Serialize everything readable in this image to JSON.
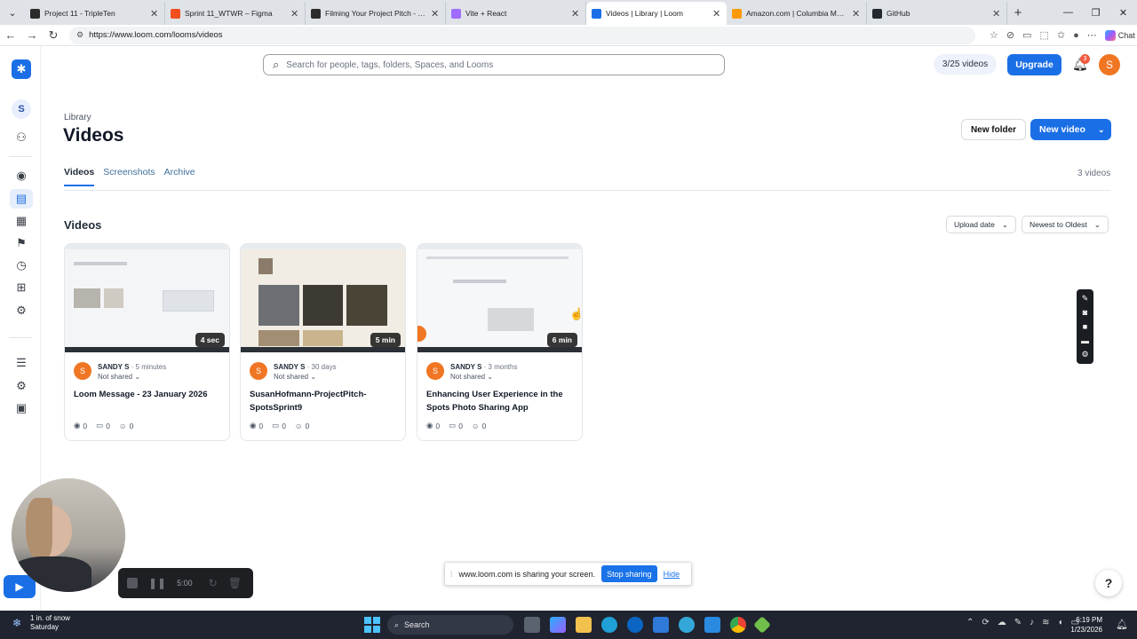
{
  "browser": {
    "tabs": [
      {
        "title": "Project 11 - TripleTen",
        "favicon_color": "#2b2b2b"
      },
      {
        "title": "Sprint 11_WTWR – Figma",
        "favicon_color": "#f24e1e"
      },
      {
        "title": "Filming Your Project Pitch - TripleTen",
        "favicon_color": "#2b2b2b"
      },
      {
        "title": "Vite + React",
        "favicon_color": "#9f6cff"
      },
      {
        "title": "Videos | Library | Loom",
        "favicon_color": "#1b6fe6"
      },
      {
        "title": "Amazon.com | Columbia Mens Bu",
        "favicon_color": "#ff9900"
      },
      {
        "title": "GitHub",
        "favicon_color": "#24292f"
      }
    ],
    "url": "https://www.loom.com/looms/videos",
    "chat_label": "Chat"
  },
  "header": {
    "search_placeholder": "Search for people, tags, folders, Spaces, and Looms",
    "video_count_pill": "3/25 videos",
    "upgrade_label": "Upgrade",
    "notification_count": "3",
    "user_initial": "S"
  },
  "rail": {
    "workspace_initial": "S"
  },
  "page": {
    "breadcrumb": "Library",
    "title": "Videos",
    "new_folder_label": "New folder",
    "new_video_label": "New video",
    "tabs": [
      {
        "label": "Videos",
        "active": true
      },
      {
        "label": "Screenshots",
        "active": false
      },
      {
        "label": "Archive",
        "active": false
      }
    ],
    "video_count_label": "3 videos",
    "section_title": "Videos",
    "sort_field": "Upload date",
    "sort_order": "Newest to Oldest"
  },
  "videos": [
    {
      "duration": "4 sec",
      "owner": "SANDY S",
      "owner_initial": "S",
      "age": "· 5 minutes",
      "sharing": "Not shared",
      "title": "Loom Message - 23 January 2026",
      "views": "0",
      "comments": "0",
      "reactions": "0"
    },
    {
      "duration": "5 min",
      "owner": "SANDY S",
      "owner_initial": "S",
      "age": "· 30 days",
      "sharing": "Not shared",
      "title": "SusanHofmann-ProjectPitch-SpotsSprint9",
      "views": "0",
      "comments": "0",
      "reactions": "0"
    },
    {
      "duration": "6 min",
      "owner": "SANDY S",
      "owner_initial": "S",
      "age": "· 3 months",
      "sharing": "Not shared",
      "title": "Enhancing User Experience in the Spots Photo Sharing App",
      "views": "0",
      "comments": "0",
      "reactions": "0"
    }
  ],
  "recorder": {
    "timer": "5:00"
  },
  "share_notice": {
    "message": "www.loom.com is sharing your screen.",
    "stop_label": "Stop sharing",
    "hide_label": "Hide"
  },
  "help_label": "?",
  "taskbar": {
    "weather_line1": "1 in. of snow",
    "weather_line2": "Saturday",
    "search_label": "Search",
    "time": "6:19 PM",
    "date": "1/23/2026"
  },
  "colors": {
    "accent": "#1b6fe6",
    "avatar": "#f07623",
    "badge": "#f15a3f"
  }
}
